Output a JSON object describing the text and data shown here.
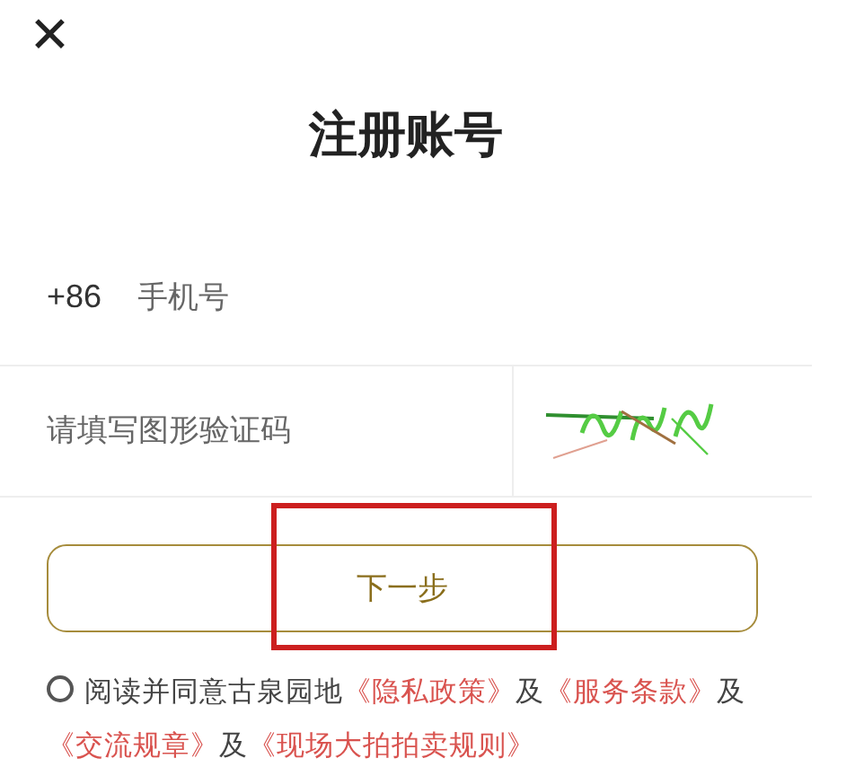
{
  "close": {
    "label": "✕"
  },
  "title": "注册账号",
  "phone": {
    "prefix": "+86",
    "placeholder": "手机号"
  },
  "captcha": {
    "placeholder": "请填写图形验证码"
  },
  "next_button": {
    "label": "下一步",
    "highlighted": true
  },
  "agreement": {
    "checked": false,
    "parts": [
      {
        "kind": "text",
        "text": "阅读并同意古泉园地"
      },
      {
        "kind": "link",
        "text": "《隐私政策》"
      },
      {
        "kind": "text",
        "text": "及"
      },
      {
        "kind": "link",
        "text": "《服务条款》"
      },
      {
        "kind": "text",
        "text": "及"
      },
      {
        "kind": "link",
        "text": "《交流规章》"
      },
      {
        "kind": "text",
        "text": "及"
      },
      {
        "kind": "link",
        "text": "《现场大拍拍卖规则》"
      }
    ]
  }
}
